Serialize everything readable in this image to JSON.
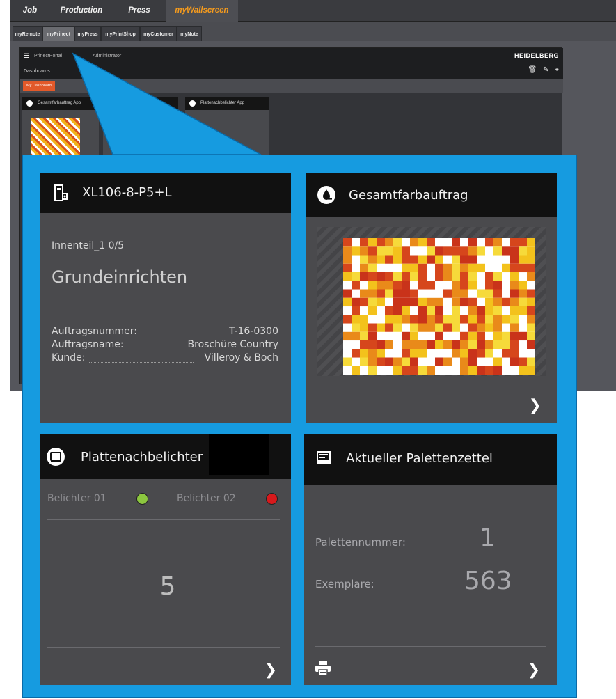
{
  "app": {
    "top_tabs": [
      {
        "label": "Job"
      },
      {
        "label": "Production"
      },
      {
        "label": "Press"
      },
      {
        "label": "myWallscreen"
      }
    ],
    "sub_tabs": [
      {
        "label": "myRemote"
      },
      {
        "label": "myPrinect"
      },
      {
        "label": "myPress"
      },
      {
        "label": "myPrintShop"
      },
      {
        "label": "myCustomer"
      },
      {
        "label": "myNote"
      }
    ]
  },
  "portal": {
    "title": "PrinectPortal",
    "user": "Administrator",
    "section": "Dashboards",
    "logo": "HEIDELBERG",
    "dashboard_button": "My Dashboard",
    "mini_tiles": [
      {
        "label": "Gesamtfarbauftrag App"
      },
      {
        "label": "Plattenachbelichter App"
      }
    ]
  },
  "tiles": {
    "machine": {
      "title": "XL106-8-P5+L",
      "icon": "machine-icon",
      "part": "Innenteil_1 0/5",
      "status": "Grundeinrichten",
      "fields": [
        {
          "label": "Auftragsnummer:",
          "value": "T-16-0300"
        },
        {
          "label": "Auftragsname:",
          "value": "Broschüre Country"
        },
        {
          "label": "Kunde:",
          "value": "Villeroy & Boch"
        }
      ]
    },
    "ink": {
      "title": "Gesamtfarbauftrag",
      "icon": "ink-drop-icon"
    },
    "platesetter": {
      "title": "Plattenachbelichter",
      "icon": "platesetter-icon",
      "exposer1": "Belichter 01",
      "exposer1_color": "#8cc63f",
      "exposer2": "Belichter 02",
      "exposer2_color": "#d7191c",
      "count": "5"
    },
    "pallet": {
      "title": "Aktueller Palettenzettel",
      "icon": "monitor-icon",
      "pallet_label": "Palettennummer:",
      "pallet_value": "1",
      "copies_label": "Exemplare:",
      "copies_value": "563"
    }
  }
}
